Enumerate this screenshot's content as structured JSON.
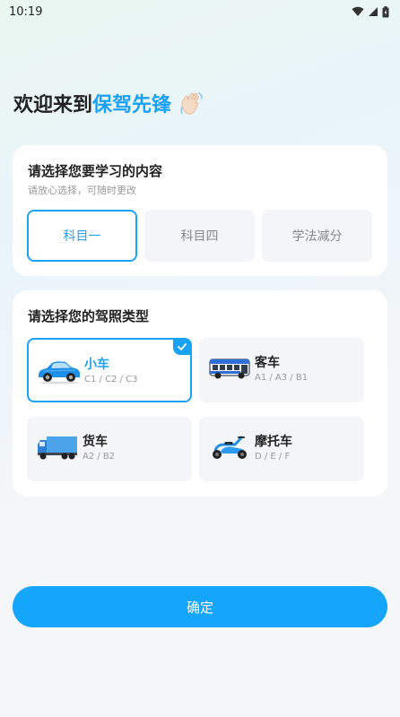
{
  "status_bar": {
    "time": "10:19"
  },
  "welcome": {
    "prefix": "欢迎来到",
    "brand": "保驾先锋"
  },
  "subject_section": {
    "title": "请选择您要学习的内容",
    "subtitle": "请放心选择，可随时更改",
    "options": [
      {
        "label": "科目一",
        "selected": true
      },
      {
        "label": "科目四",
        "selected": false
      },
      {
        "label": "学法减分",
        "selected": false
      }
    ]
  },
  "license_section": {
    "title": "请选择您的驾照类型",
    "options": [
      {
        "name": "小车",
        "codes": "C1 / C2 / C3",
        "icon": "car-icon",
        "selected": true
      },
      {
        "name": "客车",
        "codes": "A1 / A3 / B1",
        "icon": "bus-icon",
        "selected": false
      },
      {
        "name": "货车",
        "codes": "A2 / B2",
        "icon": "truck-icon",
        "selected": false
      },
      {
        "name": "摩托车",
        "codes": "D / E / F",
        "icon": "scooter-icon",
        "selected": false
      }
    ]
  },
  "confirm_label": "确定",
  "colors": {
    "accent": "#1aa2f5",
    "button": "#15a5fa"
  }
}
